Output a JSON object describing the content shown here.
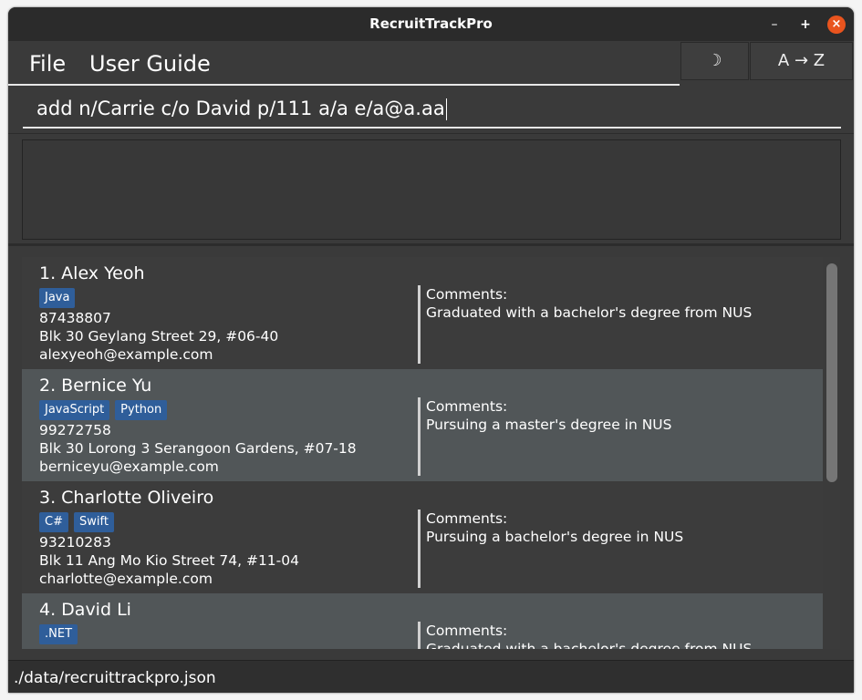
{
  "window": {
    "title": "RecruitTrackPro",
    "minimize": "–",
    "maximize": "+",
    "close": "×"
  },
  "menu": {
    "file": "File",
    "user_guide": "User Guide"
  },
  "toolbar": {
    "theme_icon": "☽",
    "sort_label": "A → Z"
  },
  "command": {
    "value": "add n/Carrie c/o David p/111 a/a e/a@a.aa"
  },
  "result": {
    "text": ""
  },
  "persons": [
    {
      "name": "1. Alex Yeoh",
      "tags": [
        "Java"
      ],
      "phone": "87438807",
      "address": "Blk 30 Geylang Street 29, #06-40",
      "email": "alexyeoh@example.com",
      "comment_label": "Comments:",
      "comment": "Graduated with a bachelor's degree from NUS"
    },
    {
      "name": "2. Bernice Yu",
      "tags": [
        "JavaScript",
        "Python"
      ],
      "phone": "99272758",
      "address": "Blk 30 Lorong 3 Serangoon Gardens, #07-18",
      "email": "berniceyu@example.com",
      "comment_label": "Comments:",
      "comment": "Pursuing a master's degree in NUS"
    },
    {
      "name": "3. Charlotte Oliveiro",
      "tags": [
        "C#",
        "Swift"
      ],
      "phone": "93210283",
      "address": "Blk 11 Ang Mo Kio Street 74, #11-04",
      "email": "charlotte@example.com",
      "comment_label": "Comments:",
      "comment": "Pursuing a bachelor's degree in NUS"
    },
    {
      "name": "4. David Li",
      "tags": [
        ".NET"
      ],
      "phone": "",
      "address": "",
      "email": "",
      "comment_label": "Comments:",
      "comment": "Graduated with a bachelor's degree from NUS"
    }
  ],
  "status": {
    "file_path": "./data/recruittrackpro.json"
  },
  "colors": {
    "tag_background": "#2f5e9a",
    "close_button": "#e9541e",
    "card_alt": "#515658"
  }
}
